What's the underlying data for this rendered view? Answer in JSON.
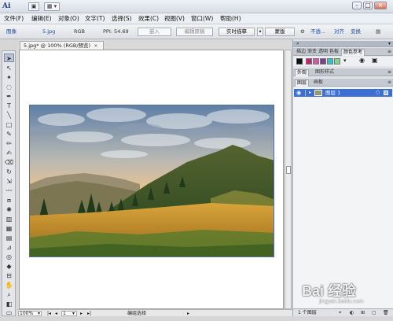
{
  "titlebar": {
    "app_logo": "Ai",
    "bridge_button": "▣",
    "arrange_button": "▦ ▾",
    "window_controls": {
      "minimize": "–",
      "restore": "□",
      "close": "×"
    }
  },
  "menu": [
    "文件(F)",
    "编辑(E)",
    "对象(O)",
    "文字(T)",
    "选择(S)",
    "效果(C)",
    "视图(V)",
    "窗口(W)",
    "帮助(H)"
  ],
  "control_bar": {
    "object_type": "图像",
    "file_name": "5.jpg",
    "color_mode": "RGB",
    "ppi": "PPI: 54.69",
    "embed_label": "嵌入",
    "edit_original_label": "编辑原稿",
    "live_trace_label": "实时描摹",
    "mask_label": "蒙版",
    "opacity_label": "不透...",
    "align_label": "对齐",
    "transform_label": "变换"
  },
  "document": {
    "tab_title": "5.jpg* @ 100% (RGB/预览)",
    "tab_close": "×",
    "zoom": "100%",
    "artboard_number": "1",
    "status_text": "编组选择"
  },
  "right_panel": {
    "tabs_row1": [
      "描边",
      "渐变",
      "透明",
      "色板",
      "颜色参考"
    ],
    "tabs_row2": [
      "外观",
      "图形样式"
    ],
    "tabs_row3": [
      "图层",
      "画板"
    ],
    "layer_name": "图层 1",
    "layer_count": "1 个图层",
    "swatch_colors": [
      "#c4236e",
      "#d05aa8",
      "#7a3f8e",
      "#2fbfd0",
      "#7fd88a"
    ]
  },
  "tools": [
    "select",
    "direct-select",
    "magic-wand",
    "lasso",
    "pen",
    "type",
    "line",
    "rectangle",
    "paintbrush",
    "pencil",
    "blob-brush",
    "eraser",
    "rotate",
    "scale",
    "warp",
    "free-transform",
    "symbol-sprayer",
    "column-graph",
    "mesh",
    "gradient",
    "eyedropper",
    "blend",
    "live-paint",
    "slice",
    "hand",
    "zoom",
    "fill-stroke",
    "screen-mode"
  ],
  "watermark": {
    "brand": "Bai 经验",
    "url": "jingyan.baidu.com"
  }
}
